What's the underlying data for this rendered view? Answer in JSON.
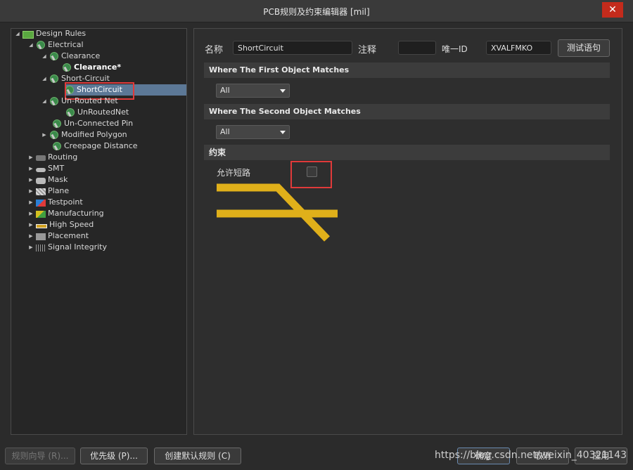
{
  "window": {
    "title": "PCB规则及约束编辑器 [mil]",
    "close_icon": "close-icon"
  },
  "tree": {
    "root": "Design Rules",
    "electrical": "Electrical",
    "clearance": "Clearance",
    "clearance_child": "Clearance*",
    "short_circuit": "Short-Circuit",
    "short_circuit_child": "ShortCircuit",
    "unrouted_net": "Un-Routed Net",
    "unrouted_net_child": "UnRoutedNet",
    "unconnected_pin": "Un-Connected Pin",
    "modified_polygon": "Modified Polygon",
    "creepage_distance": "Creepage Distance",
    "routing": "Routing",
    "smt": "SMT",
    "mask": "Mask",
    "plane": "Plane",
    "testpoint": "Testpoint",
    "manufacturing": "Manufacturing",
    "high_speed": "High Speed",
    "placement": "Placement",
    "signal_integrity": "Signal Integrity"
  },
  "rule": {
    "name_label": "名称",
    "name_value": "ShortCircuit",
    "comment_label": "注释",
    "comment_value": "",
    "uid_label": "唯一ID",
    "uid_value": "XVALFMKO",
    "test_button": "测试语句"
  },
  "first_match": {
    "header": "Where The First Object Matches",
    "selected": "All"
  },
  "second_match": {
    "header": "Where The Second Object Matches",
    "selected": "All"
  },
  "constraints": {
    "header": "约束",
    "allow_short_label": "允许短路",
    "allow_short_checked": false
  },
  "footer": {
    "rule_wizard": "规则向导 (R)...",
    "priority": "优先级 (P)...",
    "create_default": "创建默认规则 (C)",
    "ok": "确定",
    "cancel": "取消",
    "apply": "应用"
  },
  "watermark": "https://blog.csdn.net/weixin_40321143",
  "colors": {
    "selected": "#5c7896",
    "highlight_box": "#e03a3a",
    "track": "#e0b01a"
  }
}
